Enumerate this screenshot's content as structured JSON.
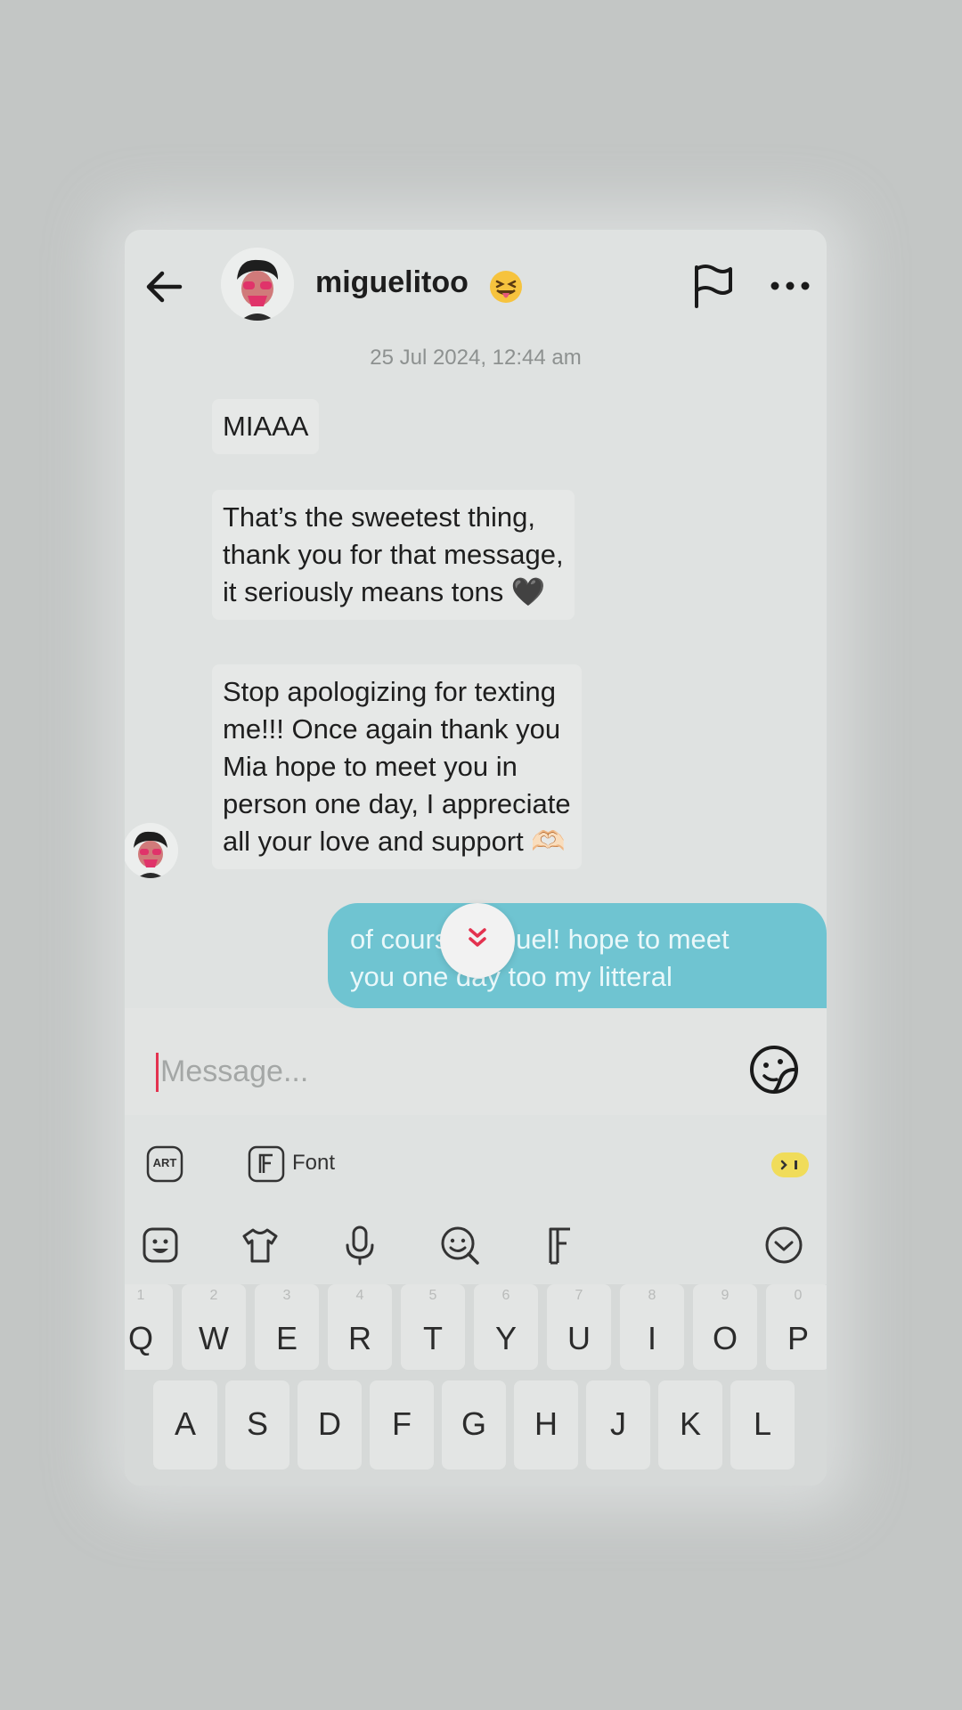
{
  "header": {
    "username": "miguelitoo",
    "username_emoji": "😝"
  },
  "timestamp": "25 Jul 2024, 12:44 am",
  "messages_incoming": [
    {
      "lines": [
        "MIAAA"
      ]
    },
    {
      "lines": [
        "That’s the sweetest thing,",
        "thank you for that message,",
        "it seriously means tons 🖤"
      ]
    },
    {
      "lines": [
        "Stop apologizing for texting",
        "me!!! Once again thank you",
        "Mia hope to meet you in",
        "person one day, I appreciate",
        "all your love and support 🫶🏻"
      ]
    }
  ],
  "message_outgoing": {
    "line1": "of course miguel! hope to meet",
    "line2": "you one day too my litteral"
  },
  "input": {
    "placeholder": "Message..."
  },
  "toolbar": {
    "art_label": "ART",
    "font_label": "Font"
  },
  "keyboard": {
    "row1": [
      {
        "key": "Q",
        "num": "1"
      },
      {
        "key": "W",
        "num": "2"
      },
      {
        "key": "E",
        "num": "3"
      },
      {
        "key": "R",
        "num": "4"
      },
      {
        "key": "T",
        "num": "5"
      },
      {
        "key": "Y",
        "num": "6"
      },
      {
        "key": "U",
        "num": "7"
      },
      {
        "key": "I",
        "num": "8"
      },
      {
        "key": "O",
        "num": "9"
      },
      {
        "key": "P",
        "num": "0"
      }
    ],
    "row2": [
      "A",
      "S",
      "D",
      "F",
      "G",
      "H",
      "J",
      "K",
      "L"
    ]
  },
  "colors": {
    "outgoing_bubble": "#6fc4d1",
    "caret": "#e3324f",
    "accent_red": "#e3324f"
  }
}
